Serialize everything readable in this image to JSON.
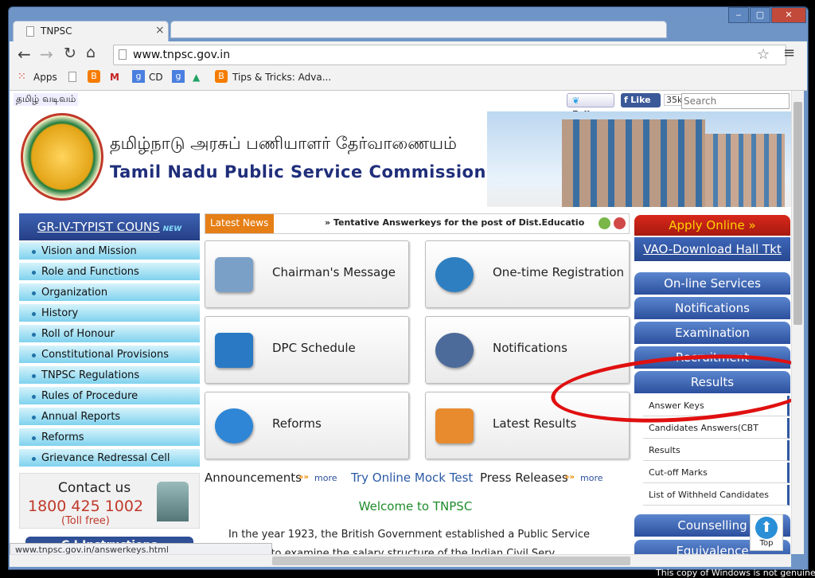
{
  "window": {
    "min": "‒",
    "max": "▢",
    "close": "✕"
  },
  "tab": {
    "title": "TNPSC",
    "close": "×"
  },
  "toolbar": {
    "url": "www.tnpsc.gov.in"
  },
  "bookmarks": {
    "apps": "Apps",
    "cd": "CD",
    "tips": "Tips & Tricks: Adva..."
  },
  "topbar": {
    "lang": "தமிழ் வடிவம்",
    "follow": "Follow",
    "like": "Like",
    "count": "35k",
    "search_placeholder": "Search"
  },
  "header": {
    "title_ta": "தமிழ்நாடு அரசுப் பணியாளர் தேர்வாணையம்",
    "title_en": "Tamil Nadu Public Service Commission"
  },
  "left": {
    "banner": "GR-IV-TYPIST COUNS",
    "new_badge": "NEW",
    "menu": [
      "Vision and Mission",
      "Role and Functions",
      "Organization",
      "History",
      "Roll of Honour",
      "Constitutional Provisions",
      "TNPSC Regulations",
      "Rules of Procedure",
      "Annual Reports",
      "Reforms",
      "Grievance Redressal Cell"
    ],
    "contact_title": "Contact us",
    "contact_phone": "1800 425 1002",
    "contact_note": "(Toll free)",
    "ci": "C.I.Instructions"
  },
  "news": {
    "label": "Latest News",
    "ticker": "» Tentative Answerkeys for the post of Dist.Educational Offi"
  },
  "cards": [
    "Chairman's Message",
    "One-time Registration",
    "DPC Schedule",
    "Notifications",
    "Reforms",
    "Latest Results"
  ],
  "links": {
    "announcements": "Announcements",
    "mock": "Try Online Mock Test",
    "press": "Press Releases",
    "more": "more"
  },
  "welcome": "Welcome to TNPSC",
  "body_text": "In the year 1923, the British Government established a Public Service",
  "body_text2": "Commission to examine the salary structure of the Indian Civil Service.",
  "right": {
    "apply": "Apply Online »",
    "vao": "VAO-Download Hall Tkt",
    "buttons": [
      "On-line Services",
      "Notifications",
      "Examination",
      "Recruitment",
      "Results"
    ],
    "sub": [
      "Answer Keys",
      "Candidates Answers(CBT exam)",
      "Results",
      "Cut-off Marks",
      "List of Withheld Candidates"
    ],
    "counselling": "Counselling",
    "equivalence": "Equivalence",
    "top": "Top"
  },
  "status": {
    "url": "www.tnpsc.gov.in/answerkeys.html"
  },
  "watermark": "This copy of Windows is not genuine",
  "colors": {
    "accent": "#2c4f9d",
    "annotation": "#e01010",
    "news": "#f08a00"
  }
}
